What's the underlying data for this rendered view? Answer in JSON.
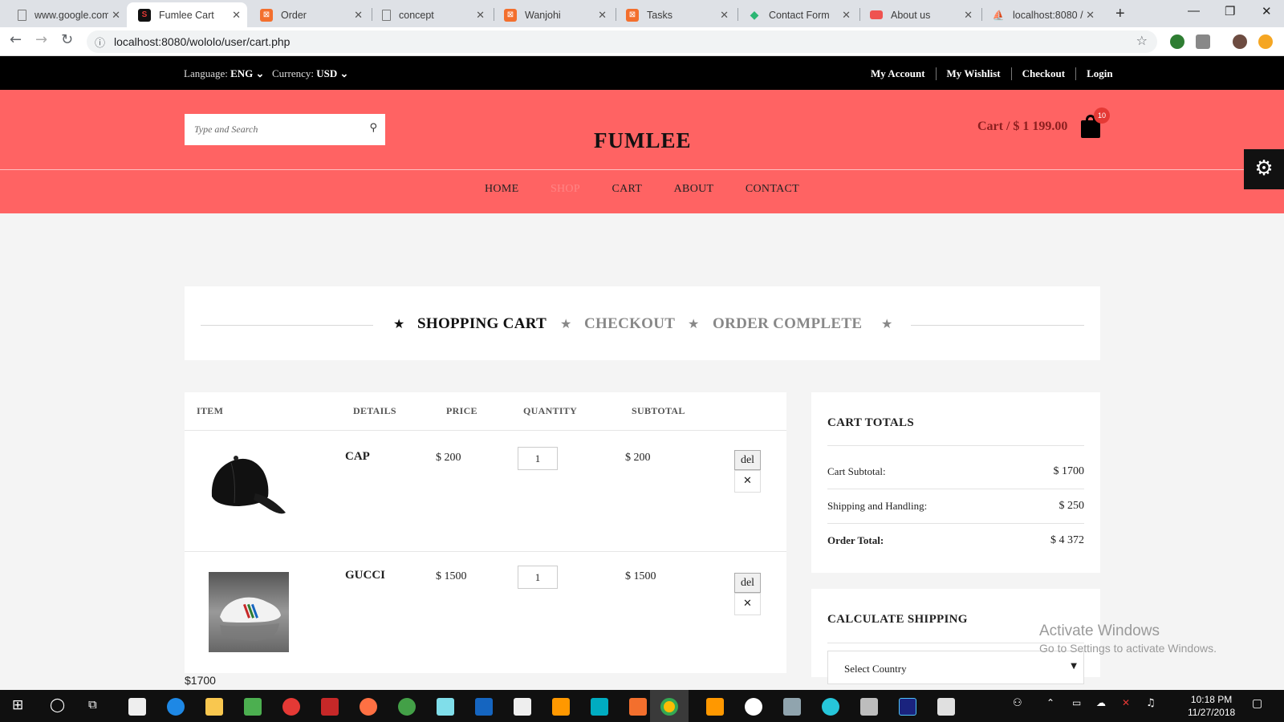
{
  "browser": {
    "tabs": [
      {
        "title": "www.google.com",
        "active": false
      },
      {
        "title": "Fumlee Cart",
        "active": true
      },
      {
        "title": "Order",
        "active": false
      },
      {
        "title": "concept",
        "active": false
      },
      {
        "title": "Wanjohi",
        "active": false
      },
      {
        "title": "Tasks",
        "active": false
      },
      {
        "title": "Contact Form",
        "active": false
      },
      {
        "title": "About us",
        "active": false
      },
      {
        "title": "localhost:8080 /",
        "active": false
      }
    ],
    "url": "localhost:8080/wololo/user/cart.php"
  },
  "topbar": {
    "language_label": "Language:",
    "language_value": "ENG",
    "currency_label": "Currency:",
    "currency_value": "USD",
    "links": [
      "My Account",
      "My Wishlist",
      "Checkout",
      "Login"
    ]
  },
  "header": {
    "search_placeholder": "Type and Search",
    "logo": "FUMLEE",
    "cart_label": "Cart / $ 1 199.00",
    "cart_count": "10",
    "nav": [
      "HOME",
      "SHOP",
      "CART",
      "ABOUT",
      "CONTACT"
    ]
  },
  "steps": [
    "SHOPPING CART",
    "CHECKOUT",
    "ORDER COMPLETE"
  ],
  "cart": {
    "headers": [
      "ITEM",
      "DETAILS",
      "PRICE",
      "QUANTITY",
      "SUBTOTAL"
    ],
    "rows": [
      {
        "name": "CAP",
        "price": "$ 200",
        "qty": "1",
        "subtotal": "$ 200",
        "del": "del",
        "remove": "✕",
        "image": "black-cap"
      },
      {
        "name": "GUCCI",
        "price": "$ 1500",
        "qty": "1",
        "subtotal": "$ 1500",
        "del": "del",
        "remove": "✕",
        "image": "sneaker"
      }
    ],
    "total_output": "$1700"
  },
  "totals": {
    "title": "CART TOTALS",
    "subtotal_label": "Cart Subtotal:",
    "subtotal": "$ 1700",
    "shipping_label": "Shipping and Handling:",
    "shipping": "$ 250",
    "order_label": "Order Total:",
    "order_total": "$ 4 372"
  },
  "shipping": {
    "title": "CALCULATE SHIPPING",
    "country_select": "Select Country"
  },
  "watermark": {
    "line1": "Activate Windows",
    "line2": "Go to Settings to activate Windows."
  },
  "taskbar": {
    "time": "10:18 PM",
    "date": "11/27/2018"
  },
  "colors": {
    "header_bg": "#ff6363",
    "topbar_bg": "#000000",
    "cart_total_text": "#8b1f1f"
  }
}
